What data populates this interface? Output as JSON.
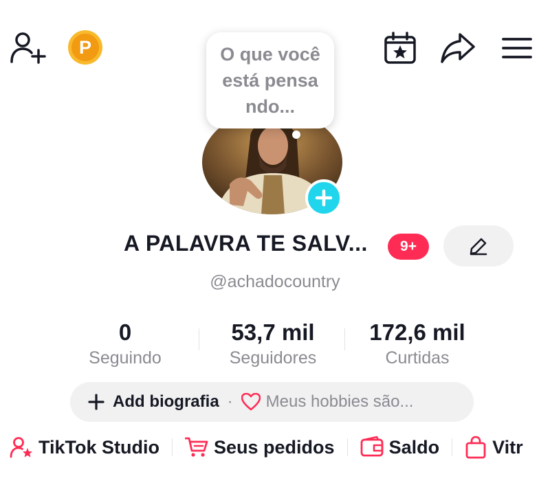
{
  "header": {
    "add_friend_icon": "person-plus-icon",
    "coin_letter": "P",
    "calendar_icon": "calendar-star-icon",
    "share_icon": "share-arrow-icon",
    "menu_icon": "hamburger-menu-icon"
  },
  "bubble": {
    "text": "O que você está pensa ndo..."
  },
  "profile": {
    "display_name": "A PALAVRA TE SALV...",
    "notification_badge": "9+",
    "username": "@achadocountry"
  },
  "stats": [
    {
      "value": "0",
      "label": "Seguindo"
    },
    {
      "value": "53,7 mil",
      "label": "Seguidores"
    },
    {
      "value": "172,6 mil",
      "label": "Curtidas"
    }
  ],
  "bio": {
    "add_label": "Add biografia",
    "separator": "·",
    "hobbies_label": "Meus hobbies são..."
  },
  "shortcuts": [
    {
      "label": "TikTok Studio",
      "icon": "person-star-icon"
    },
    {
      "label": "Seus pedidos",
      "icon": "cart-icon"
    },
    {
      "label": "Saldo",
      "icon": "wallet-icon"
    },
    {
      "label": "Vitr",
      "icon": "shopping-bag-icon"
    }
  ],
  "colors": {
    "accent": "#fe2c55",
    "avatar_add": "#20d5ec",
    "coin": "#f5a623",
    "muted_text": "#8a8b91"
  }
}
